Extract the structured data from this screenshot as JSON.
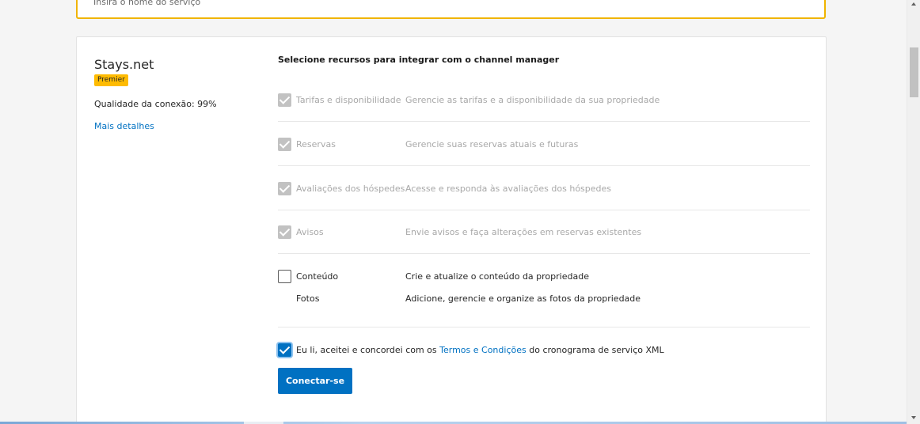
{
  "search": {
    "placeholder": "Insira o nome do serviço"
  },
  "provider": {
    "name": "Stays.net",
    "badge": "Premier",
    "quality": "Qualidade da conexão: 99%",
    "details_link": "Mais detalhes"
  },
  "features": {
    "title": "Selecione recursos para integrar com o channel manager",
    "items": [
      {
        "name": "Tarifas e disponibilidade",
        "description": "Gerencie as tarifas e a disponibilidade da sua propriedade",
        "state": "checked-disabled"
      },
      {
        "name": "Reservas",
        "description": "Gerencie suas reservas atuais e futuras",
        "state": "checked-disabled"
      },
      {
        "name": "Avaliações dos hóspedes",
        "description": "Acesse e responda às avaliações dos hóspedes",
        "state": "checked-disabled"
      },
      {
        "name": "Avisos",
        "description": "Envie avisos e faça alterações em reservas existentes",
        "state": "checked-disabled"
      },
      {
        "name": "Conteúdo",
        "description": "Crie e atualize o conteúdo da propriedade",
        "state": "unchecked"
      }
    ],
    "sub_item": {
      "name": "Fotos",
      "description": "Adicione, gerencie e organize as fotos da propriedade"
    }
  },
  "agreement": {
    "prefix": "Eu li, aceitei e concordei com os ",
    "link": "Termos e Condições",
    "suffix": " do cronograma de serviço XML",
    "checked": true
  },
  "connect_button": "Conectar-se",
  "colors": {
    "accent": "#0071c2",
    "badge": "#febb02",
    "search_border": "#f0b400"
  }
}
